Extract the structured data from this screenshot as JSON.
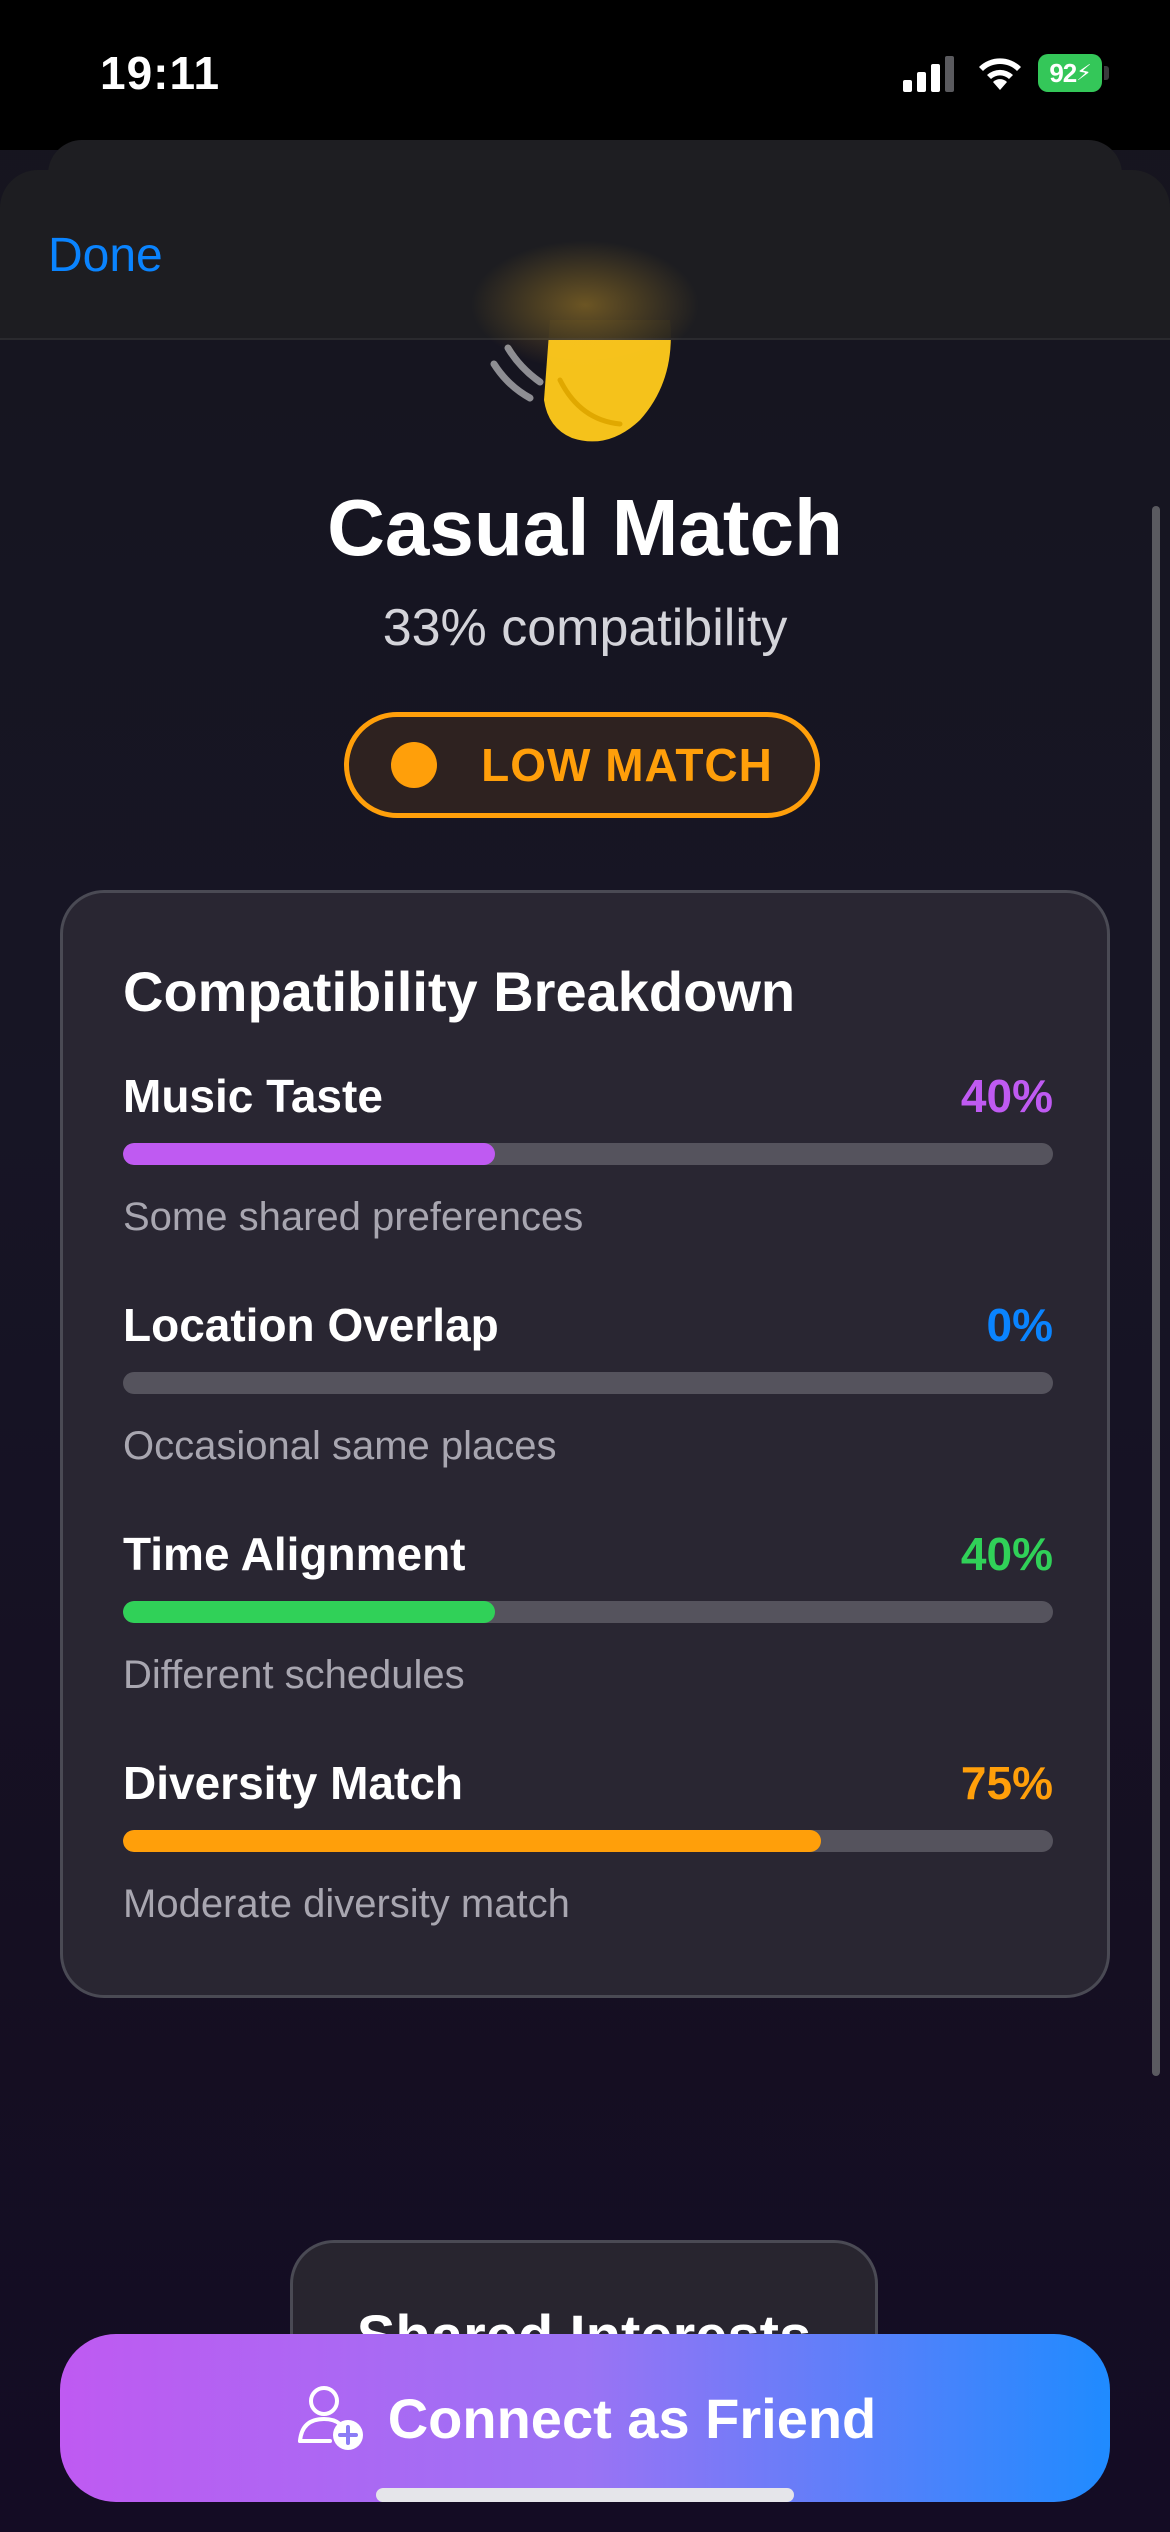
{
  "status_bar": {
    "time": "19:11",
    "battery": "92",
    "icons": [
      "cellular-signal-icon",
      "wifi-icon",
      "battery-charging-icon"
    ]
  },
  "nav": {
    "done_label": "Done"
  },
  "header": {
    "emoji_icon": "waving-hand-icon",
    "title": "Casual Match",
    "compatibility": "33% compatibility",
    "badge_label": "LOW MATCH",
    "badge_color": "#ff9f0a"
  },
  "breakdown": {
    "title": "Compatibility Breakdown",
    "items": [
      {
        "name": "Music Taste",
        "value_label": "40%",
        "value": 40,
        "color": "#bf5af2",
        "description": "Some shared preferences"
      },
      {
        "name": "Location Overlap",
        "value_label": "0%",
        "value": 0,
        "color": "#0a84ff",
        "description": "Occasional same places"
      },
      {
        "name": "Time Alignment",
        "value_label": "40%",
        "value": 40,
        "color": "#30d158",
        "description": "Different schedules"
      },
      {
        "name": "Diversity Match",
        "value_label": "75%",
        "value": 75,
        "color": "#ff9f0a",
        "description": "Moderate diversity match"
      }
    ]
  },
  "actions": {
    "shared_interests_label": "Shared Interests",
    "connect_label": "Connect as Friend",
    "connect_icon": "person-add-icon"
  },
  "colors": {
    "accent_blue": "#0a84ff",
    "gradient_start": "#bf5af2",
    "gradient_end": "#1f8bff"
  }
}
